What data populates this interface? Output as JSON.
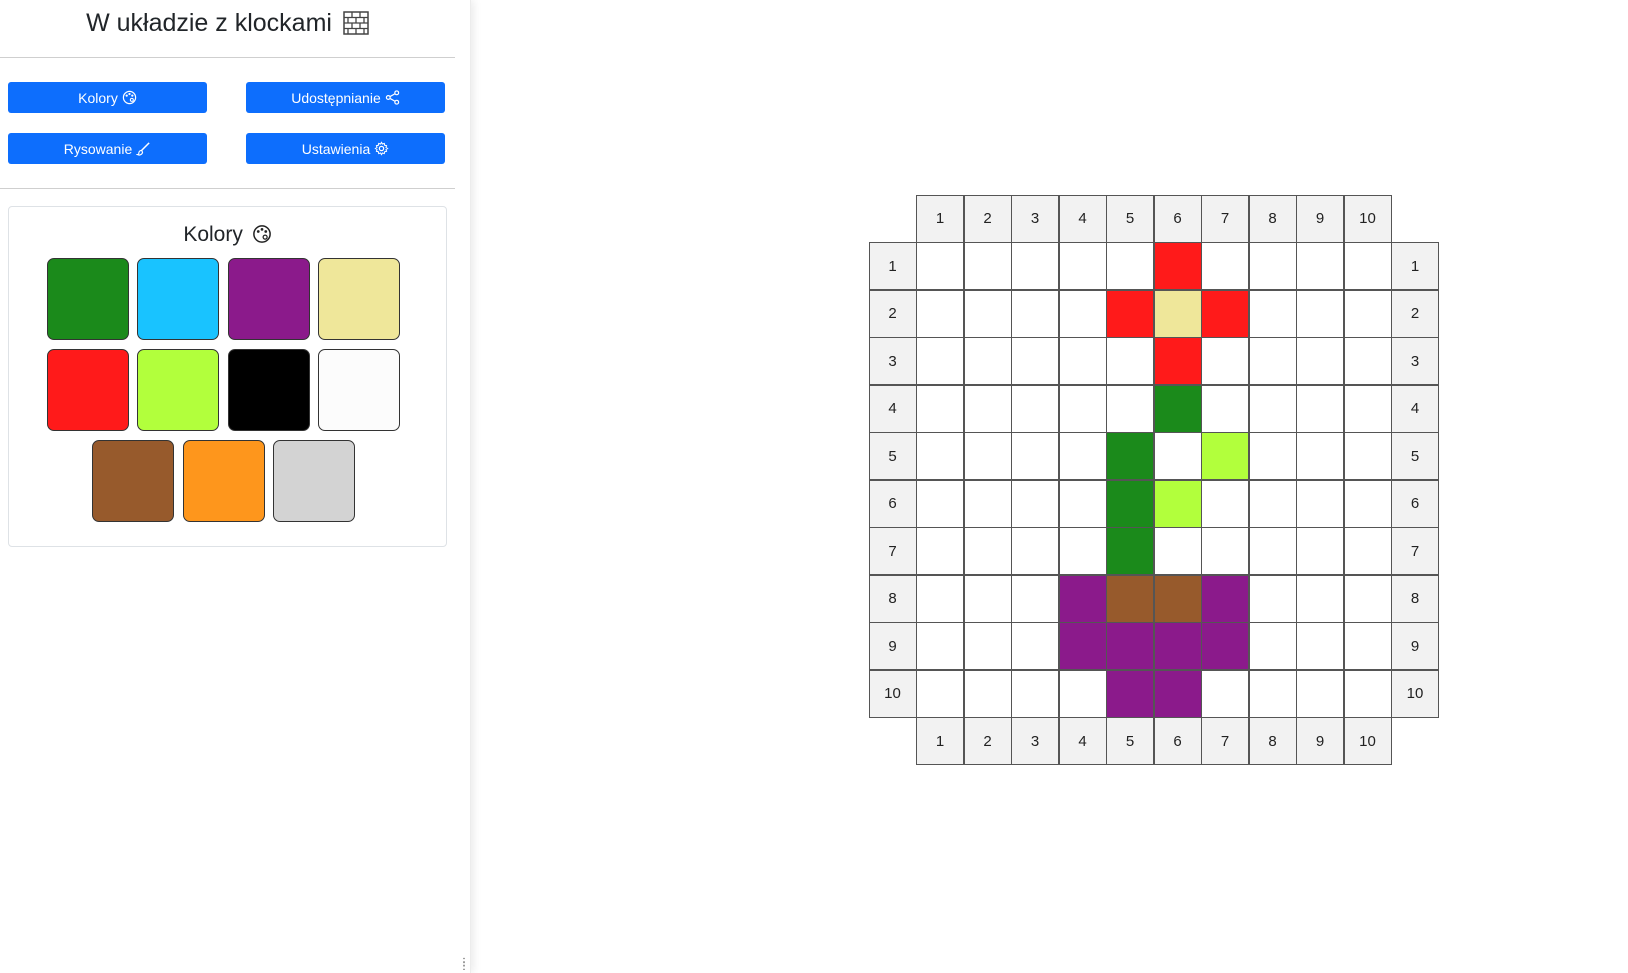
{
  "app": {
    "title": "W układzie z klockami"
  },
  "toolbar": {
    "colors_label": "Kolory",
    "sharing_label": "Udostępnianie",
    "drawing_label": "Rysowanie",
    "settings_label": "Ustawienia"
  },
  "palette": {
    "title": "Kolory",
    "colors": [
      "#1b8a1b",
      "#19c3ff",
      "#8b1a8b",
      "#efe79a",
      "#ff1a1a",
      "#b2ff3c",
      "#000000",
      "#fcfcfc",
      "#975a2c",
      "#fe961c",
      "#d3d3d3"
    ]
  },
  "board": {
    "columns": [
      "1",
      "2",
      "3",
      "4",
      "5",
      "6",
      "7",
      "8",
      "9",
      "10"
    ],
    "rows": [
      "1",
      "2",
      "3",
      "4",
      "5",
      "6",
      "7",
      "8",
      "9",
      "10"
    ],
    "cells": [
      [
        null,
        null,
        null,
        null,
        null,
        "#ff1a1a",
        null,
        null,
        null,
        null
      ],
      [
        null,
        null,
        null,
        null,
        "#ff1a1a",
        "#efe79a",
        "#ff1a1a",
        null,
        null,
        null
      ],
      [
        null,
        null,
        null,
        null,
        null,
        "#ff1a1a",
        null,
        null,
        null,
        null
      ],
      [
        null,
        null,
        null,
        null,
        null,
        "#1b8a1b",
        null,
        null,
        null,
        null
      ],
      [
        null,
        null,
        null,
        null,
        "#1b8a1b",
        null,
        "#b2ff3c",
        null,
        null,
        null
      ],
      [
        null,
        null,
        null,
        null,
        "#1b8a1b",
        "#b2ff3c",
        null,
        null,
        null,
        null
      ],
      [
        null,
        null,
        null,
        null,
        "#1b8a1b",
        null,
        null,
        null,
        null,
        null
      ],
      [
        null,
        null,
        null,
        "#8b1a8b",
        "#975a2c",
        "#975a2c",
        "#8b1a8b",
        null,
        null,
        null
      ],
      [
        null,
        null,
        null,
        "#8b1a8b",
        "#8b1a8b",
        "#8b1a8b",
        "#8b1a8b",
        null,
        null,
        null
      ],
      [
        null,
        null,
        null,
        null,
        "#8b1a8b",
        "#8b1a8b",
        null,
        null,
        null,
        null
      ]
    ]
  }
}
